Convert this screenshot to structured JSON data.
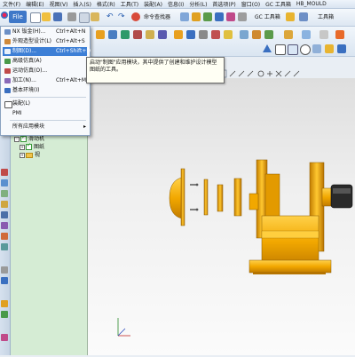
{
  "menubar": {
    "items": [
      "文件(F)",
      "编辑(E)",
      "视图(V)",
      "插入(S)",
      "格式(R)",
      "工具(T)",
      "装配(A)",
      "信息(I)",
      "分析(L)",
      "首选项(P)",
      "窗口(O)",
      "GC 工具箱",
      "HB_MOULD"
    ]
  },
  "toolbar": {
    "file_button": "File",
    "command_finder": "命令查找器",
    "gc_toolbox": "GC 工具箱",
    "toolbox": "工具箱"
  },
  "start_menu": {
    "items": [
      {
        "label": "NX 钣金(H)...",
        "shortcut": "Ctrl+Alt+N"
      },
      {
        "label": "外观造型设计(L)",
        "shortcut": "Ctrl+Alt+S"
      },
      {
        "label": "制图(D)...",
        "shortcut": "Ctrl+Shift+D"
      },
      {
        "label": "高级仿真(A)",
        "shortcut": ""
      },
      {
        "label": "运动仿真(O)...",
        "shortcut": ""
      },
      {
        "label": "加工(N)...",
        "shortcut": "Ctrl+Alt+M"
      },
      {
        "label": "基本环境(I)",
        "shortcut": ""
      },
      {
        "label": "装配(L)",
        "shortcut": ""
      },
      {
        "label": "PMI",
        "shortcut": ""
      },
      {
        "label": "所有应用模块",
        "shortcut": ""
      }
    ],
    "selected_index": 2
  },
  "tooltip": {
    "text": "启动\"制图\"应用模块，其中提供了创建和维护设计模型图纸的工具。"
  },
  "navigator": {
    "rows": [
      "滑动机",
      "图纸",
      "视"
    ]
  },
  "colors": {
    "accent": "#3d7fd6",
    "part": "#f2a800",
    "navigator_bg": "#d5ecd4"
  }
}
